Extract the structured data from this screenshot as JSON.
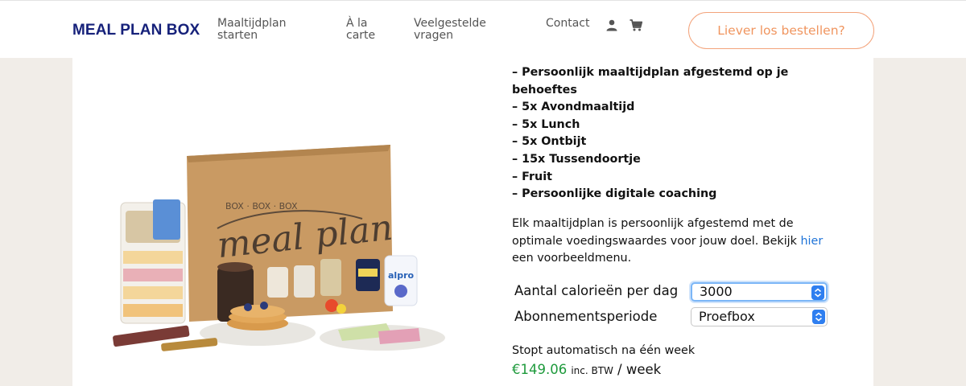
{
  "header": {
    "logo": "MEAL PLAN BOX",
    "nav": [
      {
        "label": "Maaltijdplan starten"
      },
      {
        "label": "À la carte"
      },
      {
        "label": "Veelgestelde vragen"
      },
      {
        "label": "Contact"
      }
    ],
    "icons": [
      "user-icon",
      "cart-icon"
    ],
    "cta_label": "Liever los bestellen?"
  },
  "product": {
    "box_text": "meal plan",
    "box_top_text": "BOX · BOX · BOX",
    "brand_label": "alpro"
  },
  "features": [
    "– Persoonlijk maaltijdplan afgestemd op je behoeftes",
    "– 5x Avondmaaltijd",
    "– 5x Lunch",
    "– 5x Ontbijt",
    "– 15x Tussendoortje",
    "– Fruit",
    "– Persoonlijke digitale coaching"
  ],
  "description": {
    "text_before": "Elk maaltijdplan is persoonlijk afgestemd met de optimale voedingswaardes voor jouw doel. Bekijk ",
    "link": "hier",
    "text_after": " een voorbeeldmenu."
  },
  "options": {
    "calories_label": "Aantal calorieën per dag",
    "calories_value": "3000",
    "period_label": "Abonnementsperiode",
    "period_value": "Proefbox"
  },
  "pricing": {
    "stop_text": "Stopt automatisch na één week",
    "price": "€149.06",
    "tax_note": "inc. BTW",
    "per": "/ week"
  },
  "colors": {
    "brand": "#16217a",
    "accent": "#f0955f",
    "price": "#1e9a3c",
    "link": "#1e73d8"
  }
}
